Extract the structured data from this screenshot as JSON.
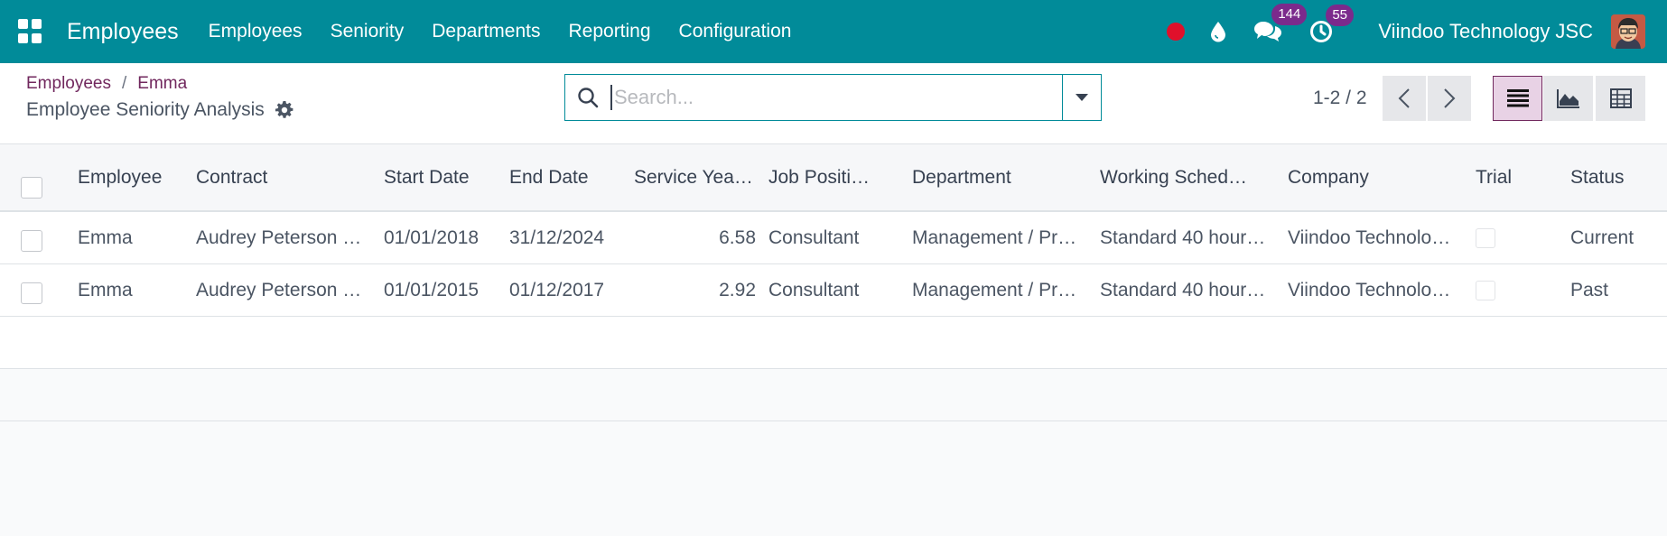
{
  "navbar": {
    "brand": "Employees",
    "menu": [
      "Employees",
      "Seniority",
      "Departments",
      "Reporting",
      "Configuration"
    ],
    "messages_count": "144",
    "activities_count": "55",
    "company": "Viindoo Technology JSC",
    "colors": {
      "bar": "#018b99",
      "badge": "#7b2a8c",
      "record": "#e0102b"
    }
  },
  "control": {
    "breadcrumb": [
      "Employees",
      "Emma"
    ],
    "breadcrumb_sep": "/",
    "title": "Employee Seniority Analysis",
    "search_placeholder": "Search...",
    "pager": "1-2 / 2"
  },
  "table": {
    "columns": [
      "Employee",
      "Contract",
      "Start Date",
      "End Date",
      "Service Yea…",
      "Job Positi…",
      "Department",
      "Working Sched…",
      "Company",
      "Trial",
      "Status"
    ],
    "rows": [
      [
        "Emma",
        "Audrey Peterson …",
        "01/01/2018",
        "31/12/2024",
        "6.58",
        "Consultant",
        "Management / Pr…",
        "Standard 40 hour…",
        "Viindoo Technolo…",
        "",
        "Current"
      ],
      [
        "Emma",
        "Audrey Peterson …",
        "01/01/2015",
        "01/12/2017",
        "2.92",
        "Consultant",
        "Management / Pr…",
        "Standard 40 hour…",
        "Viindoo Technolo…",
        "",
        "Past"
      ]
    ]
  }
}
